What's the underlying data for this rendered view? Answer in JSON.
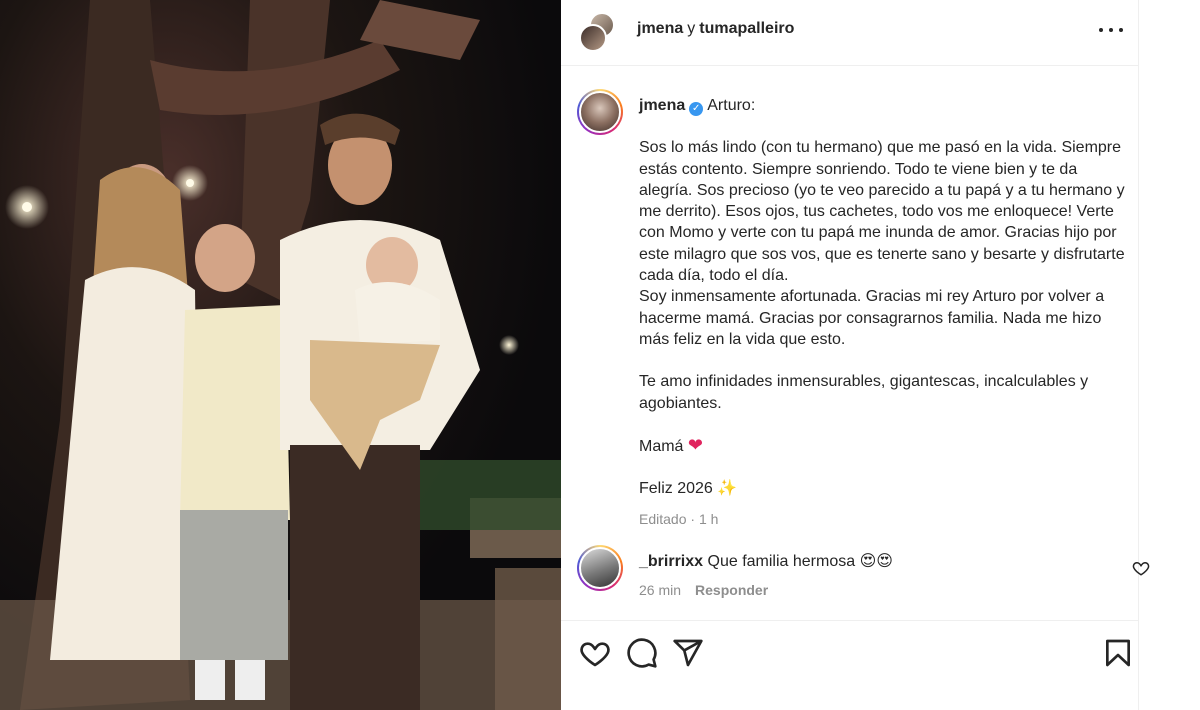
{
  "header": {
    "user1": "jmena",
    "connector": "y",
    "user2": "tumapalleiro"
  },
  "caption": {
    "username": "jmena",
    "verified_mark": "✓",
    "greeting": "Arturo:",
    "paragraph1": "Sos lo más lindo (con tu hermano) que me pasó en la vida. Siempre estás contento. Siempre sonriendo. Todo te viene bien y te da alegría. Sos precioso (yo te veo parecido a tu papá y a tu hermano y me derrito). Esos ojos, tus cachetes, todo vos me enloquece! Verte con Momo y verte con tu papá me inunda de amor. Gracias hijo por este milagro que sos vos, que es tenerte sano y besarte y disfrutarte cada día, todo el día.\nSoy inmensamente afortunada. Gracias mi rey Arturo por volver a hacerme mamá. Gracias por consagrarnos familia. Nada me hizo más feliz en la vida que esto.",
    "paragraph2": "Te amo infinidades inmensurables, gigantescas, incalculables y agobiantes.",
    "signature": "Mamá",
    "heart_emoji": "❤",
    "new_year": "Feliz 2026",
    "sparkle_emoji": "✨",
    "edited_label": "Editado",
    "separator": "·",
    "time": "1 h"
  },
  "comment": {
    "username": "_brirrixx",
    "text": "Que familia hermosa",
    "emojis": "😍😍",
    "time": "26 min",
    "reply_label": "Responder"
  },
  "icons": {
    "more": "more-options-icon",
    "like": "heart-icon",
    "comment": "comment-icon",
    "share": "share-icon",
    "save": "bookmark-icon"
  }
}
